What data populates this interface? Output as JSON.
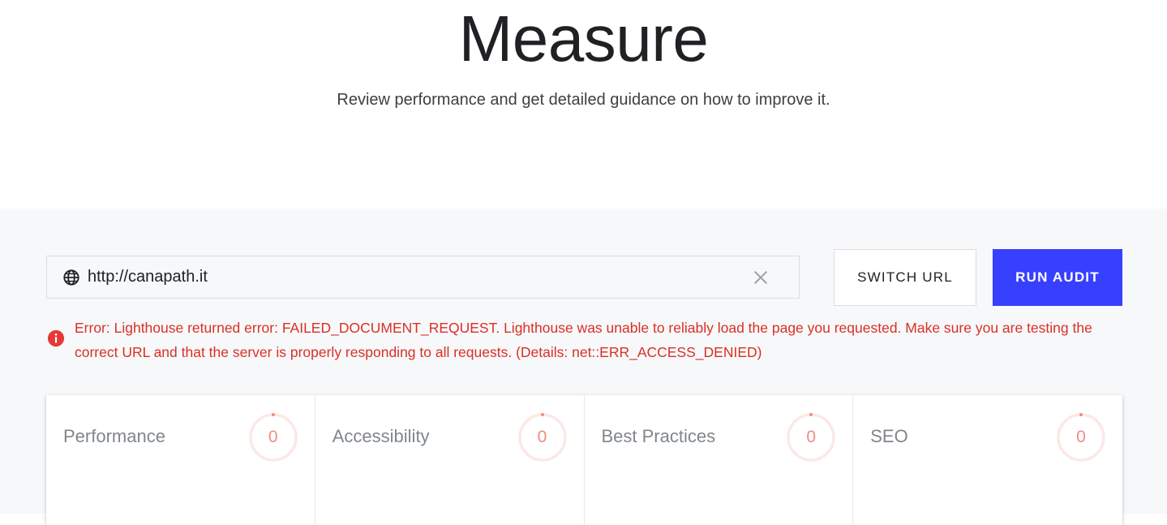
{
  "hero": {
    "title": "Measure",
    "subtitle": "Review performance and get detailed guidance on how to improve it."
  },
  "audit_form": {
    "url_value": "http://canapath.it",
    "url_icon": "globe-icon",
    "clear_icon": "close-icon",
    "switch_url_label": "SWITCH URL",
    "run_audit_label": "RUN AUDIT",
    "accent_color": "#3740ff"
  },
  "error": {
    "icon": "error-info-icon",
    "color": "#d93025",
    "message": "Error: Lighthouse returned error: FAILED_DOCUMENT_REQUEST. Lighthouse was unable to reliably load the page you requested. Make sure you are testing the correct URL and that the server is properly responding to all requests. (Details: net::ERR_ACCESS_DENIED)"
  },
  "scores": [
    {
      "label": "Performance",
      "score": "0"
    },
    {
      "label": "Accessibility",
      "score": "0"
    },
    {
      "label": "Best Practices",
      "score": "0"
    },
    {
      "label": "SEO",
      "score": "0"
    }
  ],
  "gauge_color": "#f28b82"
}
